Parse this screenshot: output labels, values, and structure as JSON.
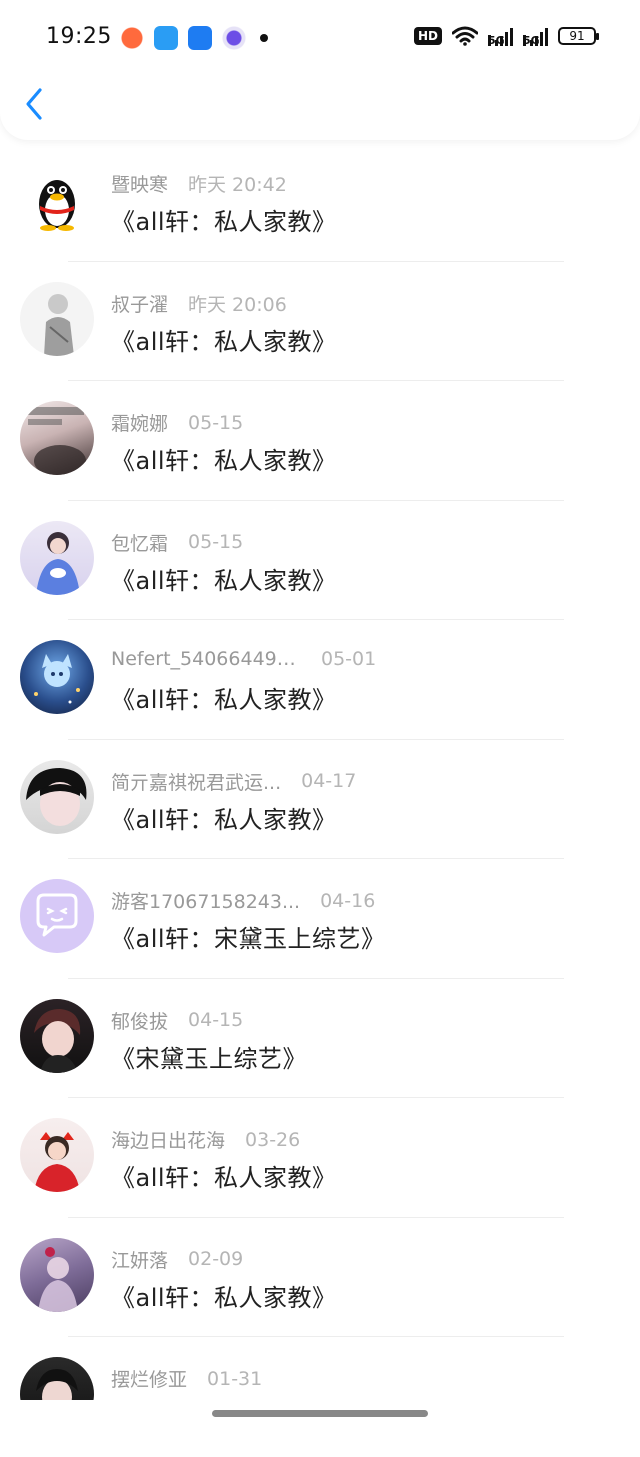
{
  "status_bar": {
    "time": "19:25",
    "hd_label": "HD",
    "signal_1_label": "5G",
    "signal_2_label": "5G",
    "battery": "91"
  },
  "messages": [
    {
      "name": "暨映寒",
      "date": "昨天 20:42",
      "title": "《all轩：私人家教》",
      "avatar": "qq-penguin-avatar"
    },
    {
      "name": "叔子濯",
      "date": "昨天 20:06",
      "title": "《all轩：私人家教》",
      "avatar": "sketch-avatar"
    },
    {
      "name": "霜婉娜",
      "date": "05-15",
      "title": "《all轩：私人家教》",
      "avatar": "photo-avatar"
    },
    {
      "name": "包忆霜",
      "date": "05-15",
      "title": "《all轩：私人家教》",
      "avatar": "photo-avatar"
    },
    {
      "name": "Nefert_540664494...",
      "date": "05-01",
      "title": "《all轩：私人家教》",
      "avatar": "anime-avatar"
    },
    {
      "name": "简亓嘉祺祝君武运...",
      "date": "04-17",
      "title": "《all轩：私人家教》",
      "avatar": "photo-avatar"
    },
    {
      "name": "游客17067158243...",
      "date": "04-16",
      "title": "《all轩：宋黛玉上综艺》",
      "avatar": "chat-bubble-avatar"
    },
    {
      "name": "郁俊拔",
      "date": "04-15",
      "title": "《宋黛玉上综艺》",
      "avatar": "photo-avatar"
    },
    {
      "name": "海边日出花海",
      "date": "03-26",
      "title": "《all轩：私人家教》",
      "avatar": "photo-avatar"
    },
    {
      "name": "江妍落",
      "date": "02-09",
      "title": "《all轩：私人家教》",
      "avatar": "photo-avatar"
    },
    {
      "name": "摆烂修亚",
      "date": "01-31",
      "title": "",
      "avatar": "photo-avatar"
    }
  ],
  "colors": {
    "accent": "#1a8cff",
    "name_text": "#999999",
    "title_text": "#222222"
  }
}
